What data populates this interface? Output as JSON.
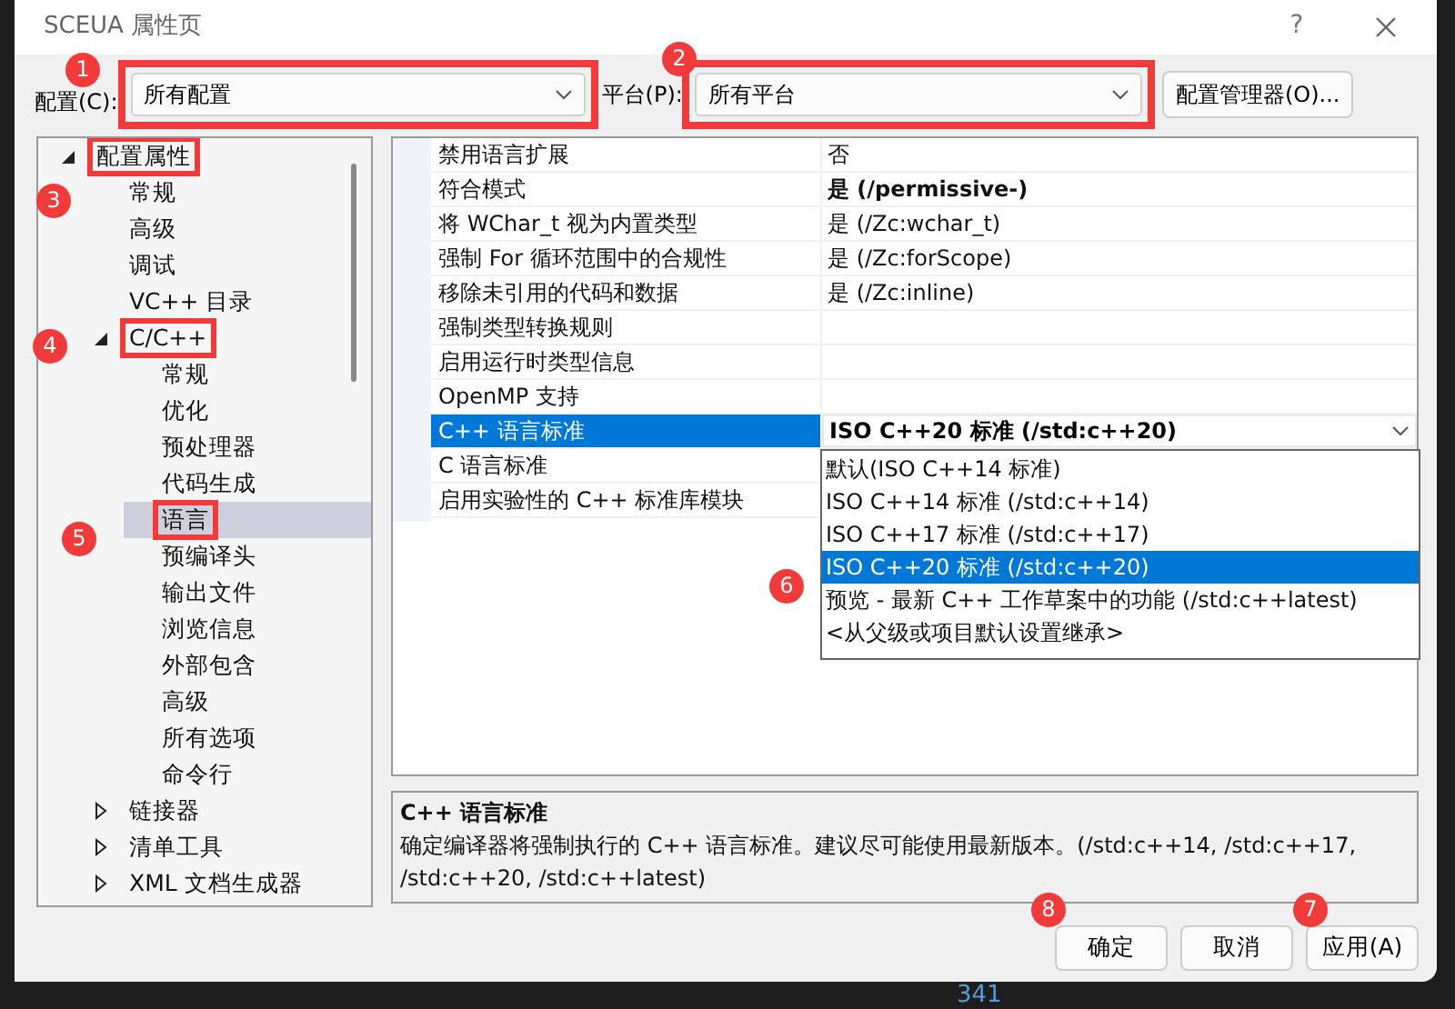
{
  "window": {
    "title": "SCEUA 属性页",
    "help": "?"
  },
  "config": {
    "label": "配置(C):",
    "value": "所有配置",
    "highlighted": true
  },
  "platform": {
    "label": "平台(P):",
    "value": "所有平台",
    "highlighted": true
  },
  "config_manager_button": "配置管理器(O)...",
  "tree": [
    {
      "label": "配置属性",
      "expanded": true,
      "highlighted": true,
      "selected": false,
      "children": [
        {
          "label": "常规",
          "highlighted": false,
          "selected": false
        },
        {
          "label": "高级",
          "highlighted": false,
          "selected": false
        },
        {
          "label": "调试",
          "highlighted": false,
          "selected": false
        },
        {
          "label": "VC++ 目录",
          "highlighted": false,
          "selected": false
        },
        {
          "label": "C/C++",
          "expanded": true,
          "highlighted": true,
          "selected": false,
          "children": [
            {
              "label": "常规",
              "highlighted": false,
              "selected": false
            },
            {
              "label": "优化",
              "highlighted": false,
              "selected": false
            },
            {
              "label": "预处理器",
              "highlighted": false,
              "selected": false
            },
            {
              "label": "代码生成",
              "highlighted": false,
              "selected": false
            },
            {
              "label": "语言",
              "highlighted": true,
              "selected": true
            },
            {
              "label": "预编译头",
              "highlighted": false,
              "selected": false
            },
            {
              "label": "输出文件",
              "highlighted": false,
              "selected": false
            },
            {
              "label": "浏览信息",
              "highlighted": false,
              "selected": false
            },
            {
              "label": "外部包含",
              "highlighted": false,
              "selected": false
            },
            {
              "label": "高级",
              "highlighted": false,
              "selected": false
            },
            {
              "label": "所有选项",
              "highlighted": false,
              "selected": false
            },
            {
              "label": "命令行",
              "highlighted": false,
              "selected": false
            }
          ]
        },
        {
          "label": "链接器",
          "expanded": false,
          "highlighted": false,
          "selected": false
        },
        {
          "label": "清单工具",
          "expanded": false,
          "highlighted": false,
          "selected": false
        },
        {
          "label": "XML 文档生成器",
          "expanded": false,
          "highlighted": false,
          "selected": false
        }
      ]
    }
  ],
  "properties": [
    {
      "name": "禁用语言扩展",
      "value": "否",
      "bold": false,
      "selected": false
    },
    {
      "name": "符合模式",
      "value": "是 (/permissive-)",
      "bold": true,
      "selected": false
    },
    {
      "name": "将 WChar_t 视为内置类型",
      "value": "是 (/Zc:wchar_t)",
      "bold": false,
      "selected": false
    },
    {
      "name": "强制 For 循环范围中的合规性",
      "value": "是 (/Zc:forScope)",
      "bold": false,
      "selected": false
    },
    {
      "name": "移除未引用的代码和数据",
      "value": "是 (/Zc:inline)",
      "bold": false,
      "selected": false
    },
    {
      "name": "强制类型转换规则",
      "selected": false
    },
    {
      "name": "启用运行时类型信息",
      "selected": false
    },
    {
      "name": "OpenMP 支持",
      "selected": false
    },
    {
      "name": "C++ 语言标准",
      "value": "ISO C++20 标准 (/std:c++20)",
      "bold": true,
      "selected": true
    },
    {
      "name": "C 语言标准",
      "selected": false
    },
    {
      "name": "启用实验性的 C++ 标准库模块",
      "selected": false
    }
  ],
  "dropdown_options": [
    {
      "label": "默认(ISO C++14 标准)",
      "selected": false
    },
    {
      "label": "ISO C++14 标准 (/std:c++14)",
      "selected": false
    },
    {
      "label": "ISO C++17 标准 (/std:c++17)",
      "selected": false
    },
    {
      "label": "ISO C++20 标准 (/std:c++20)",
      "selected": true
    },
    {
      "label": "预览 - 最新 C++ 工作草案中的功能 (/std:c++latest)",
      "selected": false
    },
    {
      "label": "<从父级或项目默认设置继承>",
      "selected": false
    }
  ],
  "description": {
    "title": "C++ 语言标准",
    "text": "确定编译器将强制执行的 C++ 语言标准。建议尽可能使用最新版本。(/std:c++14, /std:c++17, /std:c++20, /std:c++latest)"
  },
  "buttons": [
    {
      "label": "确定"
    },
    {
      "label": "取消"
    },
    {
      "label": "应用(A)"
    }
  ],
  "annotations": [
    "1",
    "2",
    "3",
    "4",
    "5",
    "6",
    "7",
    "8"
  ],
  "editor_line_number": "341"
}
